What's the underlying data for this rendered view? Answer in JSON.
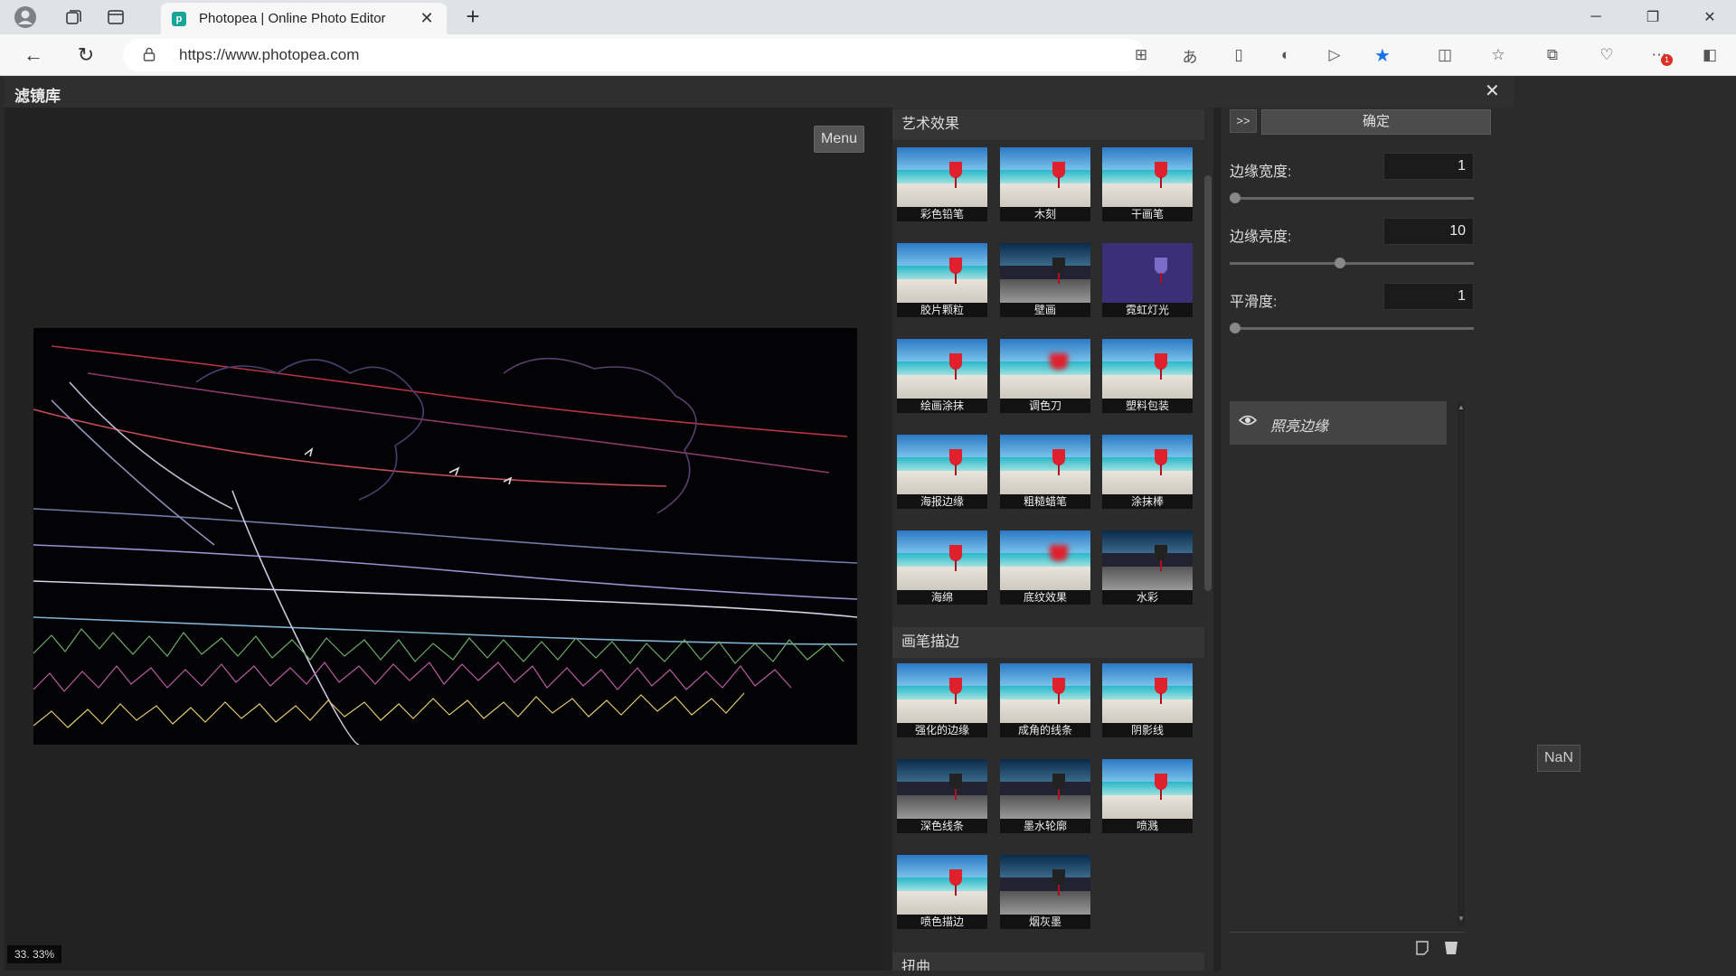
{
  "browser": {
    "tab_title": "Photopea | Online Photo Editor",
    "favicon_text": "p",
    "url": "https://www.photopea.com",
    "notification_count": "1"
  },
  "dialog": {
    "title": "滤镜库",
    "menu_label": "Menu",
    "zoom": "33. 33%",
    "collapse_label": ">>",
    "ok_label": "确定"
  },
  "gallery": {
    "categories": [
      {
        "name": "艺术效果",
        "filters": [
          "彩色铅笔",
          "木刻",
          "干画笔",
          "胶片颗粒",
          "壁画",
          "霓虹灯光",
          "绘画涂抹",
          "调色刀",
          "塑料包装",
          "海报边缘",
          "粗糙蜡笔",
          "涂抹棒",
          "海绵",
          "底纹效果",
          "水彩"
        ]
      },
      {
        "name": "画笔描边",
        "filters": [
          "强化的边缘",
          "成角的线条",
          "阴影线",
          "深色线条",
          "墨水轮廓",
          "喷溅",
          "喷色描边",
          "烟灰墨"
        ]
      },
      {
        "name": "扭曲",
        "filters": []
      }
    ]
  },
  "params": {
    "edge_width": {
      "label": "边缘宽度:",
      "value": "1",
      "level": 0.0
    },
    "edge_brightness": {
      "label": "边缘亮度:",
      "value": "10",
      "level": 0.45
    },
    "smoothness": {
      "label": "平滑度:",
      "value": "1",
      "level": 0.0
    }
  },
  "effect_layers": [
    {
      "name": "照亮边缘",
      "visible": true
    }
  ],
  "side": {
    "nan_label": "NaN"
  },
  "colors": {
    "accent_blue": "#1a73e8",
    "dialog_bg": "#232323",
    "panel_bg": "#2b2b2b"
  }
}
